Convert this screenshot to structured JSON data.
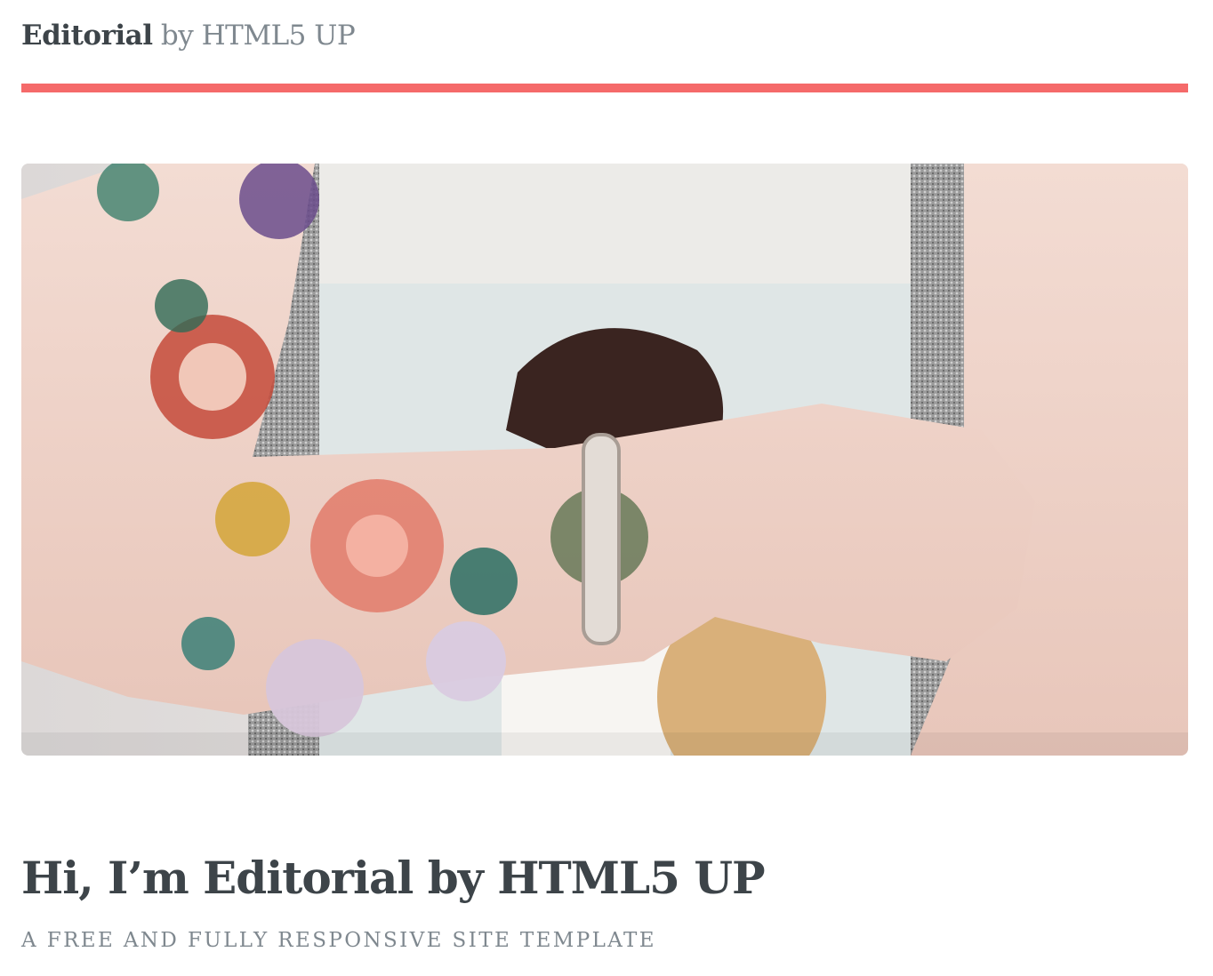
{
  "header": {
    "logo_brand": "Editorial",
    "logo_suffix": " by HTML5 UP",
    "accent_color": "#f56a6a"
  },
  "banner": {
    "title": "Hi, I’m Editorial by HTML5 UP",
    "tagline": "A free and fully responsive site template",
    "image_subject": "tattooed arm holding a magazine"
  }
}
